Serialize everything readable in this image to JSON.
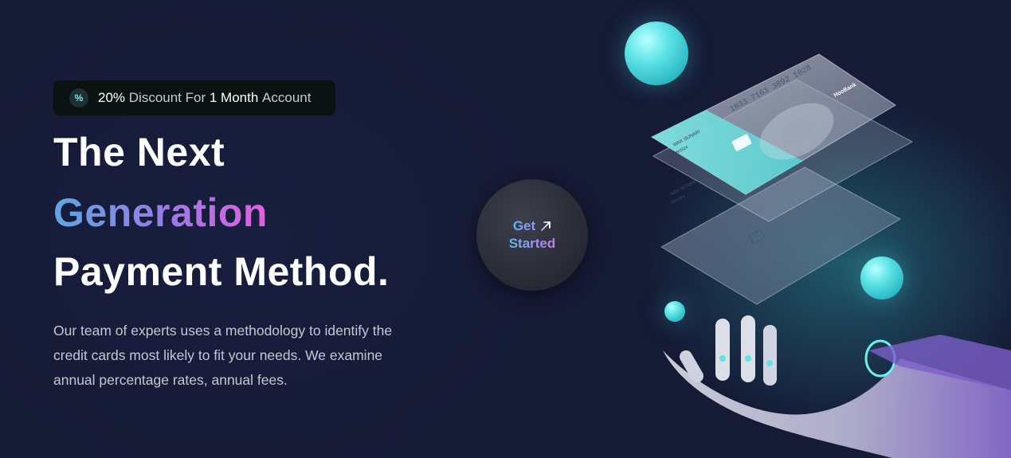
{
  "badge": {
    "icon": "percent-icon",
    "percent": "20%",
    "text_a": "Discount For",
    "duration": "1 Month",
    "text_b": "Account"
  },
  "heading": {
    "line1": "The Next",
    "line2": "Generation",
    "line3": "Payment Method."
  },
  "description": "Our team of experts uses a methodology to identify the credit cards most likely to fit your needs. We examine annual percentage rates, annual fees.",
  "cta": {
    "line1": "Get",
    "line2": "Started",
    "icon": "arrow-up-right-icon"
  },
  "cards": {
    "front": {
      "number": "1833 7163 3892 1028",
      "brand": "HooBank",
      "holder": "WAK SUNARI",
      "expiry": "09/2024"
    },
    "back": {
      "holder": "WAK SUNARI",
      "expiry": "09/2024"
    }
  },
  "colors": {
    "background": "#151a35",
    "accent_teal": "#5ee4e6",
    "gradient_start": "#5ea6df",
    "gradient_end": "#e35fdc"
  }
}
